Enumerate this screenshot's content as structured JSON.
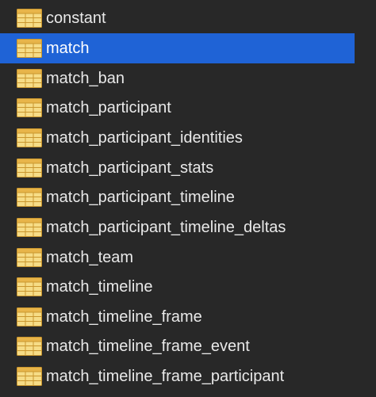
{
  "table_list": {
    "selected_index": 1,
    "items": [
      {
        "label": "constant",
        "icon": "table-icon"
      },
      {
        "label": "match",
        "icon": "table-icon"
      },
      {
        "label": "match_ban",
        "icon": "table-icon"
      },
      {
        "label": "match_participant",
        "icon": "table-icon"
      },
      {
        "label": "match_participant_identities",
        "icon": "table-icon"
      },
      {
        "label": "match_participant_stats",
        "icon": "table-icon"
      },
      {
        "label": "match_participant_timeline",
        "icon": "table-icon"
      },
      {
        "label": "match_participant_timeline_deltas",
        "icon": "table-icon"
      },
      {
        "label": "match_team",
        "icon": "table-icon"
      },
      {
        "label": "match_timeline",
        "icon": "table-icon"
      },
      {
        "label": "match_timeline_frame",
        "icon": "table-icon"
      },
      {
        "label": "match_timeline_frame_event",
        "icon": "table-icon"
      },
      {
        "label": "match_timeline_frame_participant",
        "icon": "table-icon"
      }
    ]
  },
  "colors": {
    "background": "#282828",
    "selection": "#1f63d6",
    "text": "#e9e9e9",
    "icon_fill": "#f3d36b",
    "icon_header": "#e8b54a"
  }
}
